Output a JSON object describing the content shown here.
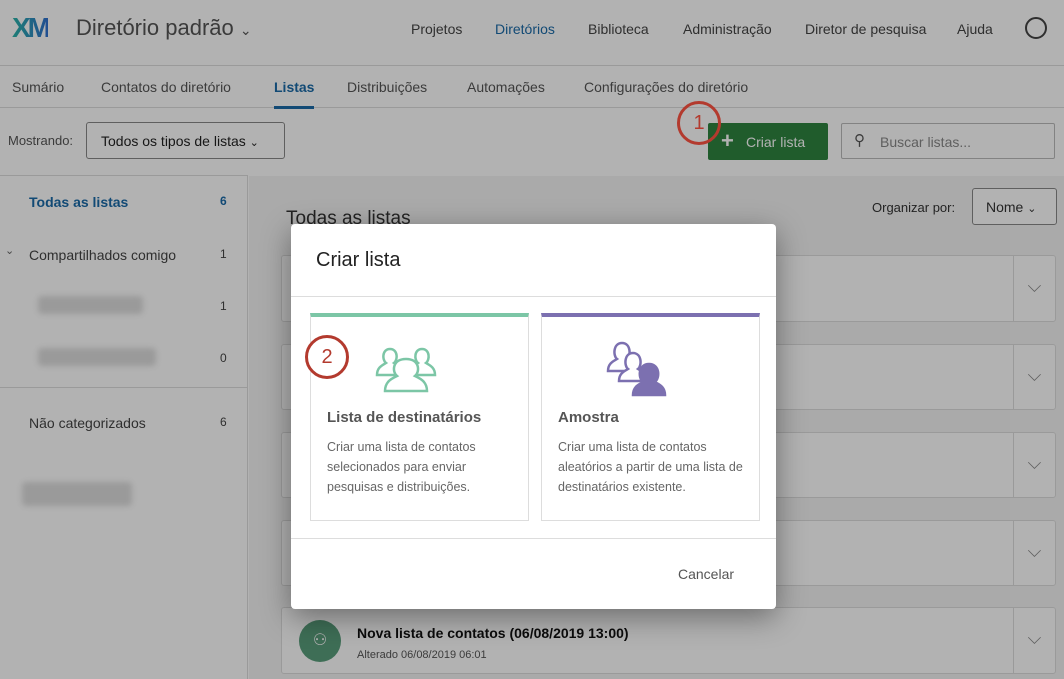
{
  "header": {
    "logo": "XM",
    "directory": "Diretório padrão",
    "nav": [
      "Projetos",
      "Diretórios",
      "Biblioteca",
      "Administração",
      "Diretor de pesquisa",
      "Ajuda"
    ]
  },
  "tabs": [
    "Sumário",
    "Contatos do diretório",
    "Listas",
    "Distribuições",
    "Automações",
    "Configurações do diretório"
  ],
  "toolbar": {
    "showing_label": "Mostrando:",
    "filter": "Todos os tipos de listas",
    "create": "Criar lista",
    "search_placeholder": "Buscar listas..."
  },
  "sidebar": {
    "all": "Todas as listas",
    "all_count": "6",
    "shared": "Compartilhados comigo",
    "shared_count": "1",
    "sub1_count": "1",
    "sub2_count": "0",
    "uncat": "Não categorizados",
    "uncat_count": "6"
  },
  "main": {
    "title": "Todas as listas",
    "sort_label": "Organizar por:",
    "sort_value": "Nome",
    "last_list": {
      "name": "Nova lista de contatos (06/08/2019 13:00)",
      "modified": "Alterado 06/08/2019 06:01"
    }
  },
  "modal": {
    "title": "Criar lista",
    "options": [
      {
        "title": "Lista de destinatários",
        "desc": "Criar uma lista de contatos selecionados para enviar pesquisas e distribuições.",
        "color": "#7cc6a6"
      },
      {
        "title": "Amostra",
        "desc": "Criar uma lista de contatos aleatórios a partir de uma lista de destinatários existente.",
        "color": "#7c70b0"
      }
    ],
    "cancel": "Cancelar"
  },
  "annotations": [
    "1",
    "2"
  ]
}
